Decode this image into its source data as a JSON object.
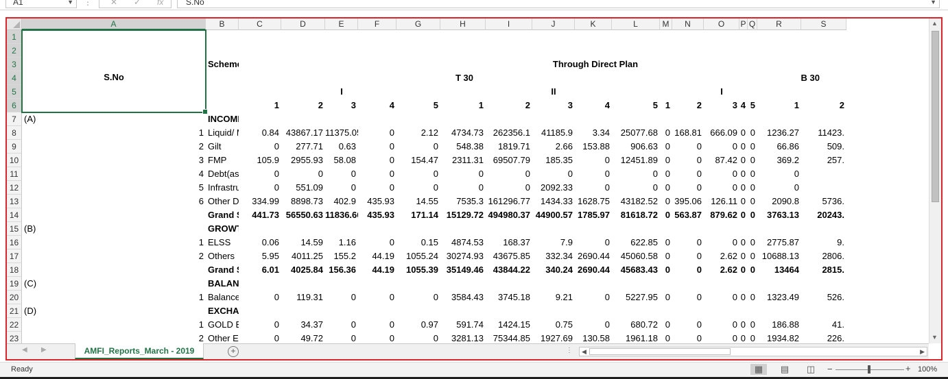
{
  "formula_bar": {
    "name_box": "A1",
    "formula": "S.No",
    "cancel_glyph": "✕",
    "enter_glyph": "✓",
    "fx_glyph": "fx"
  },
  "columns": [
    "A",
    "B",
    "C",
    "D",
    "E",
    "F",
    "G",
    "H",
    "I",
    "J",
    "K",
    "L",
    "M",
    "N",
    "O",
    "P",
    "Q",
    "R",
    "S"
  ],
  "rows": [
    "1",
    "2",
    "3",
    "4",
    "5",
    "6",
    "7",
    "8",
    "9",
    "10",
    "11",
    "12",
    "13",
    "14",
    "15",
    "16",
    "17",
    "18",
    "19",
    "20",
    "21",
    "22",
    "23"
  ],
  "cells": {
    "A3": "S.No",
    "B3": "Scheme Category / Scheme Name",
    "K3": "Through Direct Plan",
    "H4": "T 30",
    "S4": "B 30",
    "E5": "I",
    "J5": "II",
    "O5": "I",
    "C6": "1",
    "D6": "2",
    "E6": "3",
    "F6": "4",
    "G6": "5",
    "H6": "1",
    "I6": "2",
    "J6": "3",
    "K6": "4",
    "L6": "5",
    "M6": "1",
    "N6": "2",
    "O6": "3",
    "P6": "4",
    "Q6": "5",
    "R6": "1",
    "S6": "2",
    "A7": "(A)",
    "B7": "INCOME / DEBT ORIENTED SCHEMES",
    "A8": "1",
    "B8": "Liquid/ Money Market",
    "C8": "0.84",
    "D8": "43867.17",
    "E8": "11375.05",
    "F8": "0",
    "G8": "2.12",
    "H8": "4734.73",
    "I8": "262356.1",
    "J8": "41185.9",
    "K8": "3.34",
    "L8": "25077.68",
    "M8": "0",
    "N8": "168.81",
    "O8": "666.09",
    "P8": "0",
    "Q8": "0",
    "R8": "1236.27",
    "S8": "11423.",
    "A9": "2",
    "B9": "Gilt",
    "C9": "0",
    "D9": "277.71",
    "E9": "0.63",
    "F9": "0",
    "G9": "0",
    "H9": "548.38",
    "I9": "1819.71",
    "J9": "2.66",
    "K9": "153.88",
    "L9": "906.63",
    "M9": "0",
    "N9": "0",
    "O9": "0",
    "P9": "0",
    "Q9": "0",
    "R9": "66.86",
    "S9": "509.",
    "A10": "3",
    "B10": "FMP",
    "C10": "105.9",
    "D10": "2955.93",
    "E10": "58.08",
    "F10": "0",
    "G10": "154.47",
    "H10": "2311.31",
    "I10": "69507.79",
    "J10": "185.35",
    "K10": "0",
    "L10": "12451.89",
    "M10": "0",
    "N10": "0",
    "O10": "87.42",
    "P10": "0",
    "Q10": "0",
    "R10": "369.2",
    "S10": "257.",
    "A11": "4",
    "B11": "Debt(assured return)",
    "C11": "0",
    "D11": "0",
    "E11": "0",
    "F11": "0",
    "G11": "0",
    "H11": "0",
    "I11": "0",
    "J11": "0",
    "K11": "0",
    "L11": "0",
    "M11": "0",
    "N11": "0",
    "O11": "0",
    "P11": "0",
    "Q11": "0",
    "R11": "0",
    "A12": "5",
    "B12": "Infrastructure Debt Funds",
    "C12": "0",
    "D12": "551.09",
    "E12": "0",
    "F12": "0",
    "G12": "0",
    "H12": "0",
    "I12": "0",
    "J12": "2092.33",
    "K12": "0",
    "L12": "0",
    "M12": "0",
    "N12": "0",
    "O12": "0",
    "P12": "0",
    "Q12": "0",
    "R12": "0",
    "A13": "6",
    "B13": "Other Debt Schemes",
    "C13": "334.99",
    "D13": "8898.73",
    "E13": "402.9",
    "F13": "435.93",
    "G13": "14.55",
    "H13": "7535.3",
    "I13": "161296.77",
    "J13": "1434.33",
    "K13": "1628.75",
    "L13": "43182.52",
    "M13": "0",
    "N13": "395.06",
    "O13": "126.11",
    "P13": "0",
    "Q13": "0",
    "R13": "2090.8",
    "S13": "5736.",
    "B14": "Grand Sub-Total",
    "C14": "441.73",
    "D14": "56550.63",
    "E14": "11836.66",
    "F14": "435.93",
    "G14": "171.14",
    "H14": "15129.72",
    "I14": "494980.37",
    "J14": "44900.57",
    "K14": "1785.97",
    "L14": "81618.72",
    "M14": "0",
    "N14": "563.87",
    "O14": "879.62",
    "P14": "0",
    "Q14": "0",
    "R14": "3763.13",
    "S14": "20243.",
    "A15": "(B)",
    "B15": "GROWTH / EQUITY ORIENTED SCHEMES",
    "A16": "1",
    "B16": "ELSS",
    "C16": "0.06",
    "D16": "14.59",
    "E16": "1.16",
    "F16": "0",
    "G16": "0.15",
    "H16": "4874.53",
    "I16": "168.37",
    "J16": "7.9",
    "K16": "0",
    "L16": "622.85",
    "M16": "0",
    "N16": "0",
    "O16": "0",
    "P16": "0",
    "Q16": "0",
    "R16": "2775.87",
    "S16": "9.",
    "A17": "2",
    "B17": "Others",
    "C17": "5.95",
    "D17": "4011.25",
    "E17": "155.2",
    "F17": "44.19",
    "G17": "1055.24",
    "H17": "30274.93",
    "I17": "43675.85",
    "J17": "332.34",
    "K17": "2690.44",
    "L17": "45060.58",
    "M17": "0",
    "N17": "0",
    "O17": "2.62",
    "P17": "0",
    "Q17": "0",
    "R17": "10688.13",
    "S17": "2806.",
    "B18": "Grand Sub-Total",
    "C18": "6.01",
    "D18": "4025.84",
    "E18": "156.36",
    "F18": "44.19",
    "G18": "1055.39",
    "H18": "35149.46",
    "I18": "43844.22",
    "J18": "340.24",
    "K18": "2690.44",
    "L18": "45683.43",
    "M18": "0",
    "N18": "0",
    "O18": "2.62",
    "P18": "0",
    "Q18": "0",
    "R18": "13464",
    "S18": "2815.",
    "A19": "(C)",
    "B19": "BALANCED SCHEMES",
    "A20": "1",
    "B20": "Balanced schemes",
    "C20": "0",
    "D20": "119.31",
    "E20": "0",
    "F20": "0",
    "G20": "0",
    "H20": "3584.43",
    "I20": "3745.18",
    "J20": "9.21",
    "K20": "0",
    "L20": "5227.95",
    "M20": "0",
    "N20": "0",
    "O20": "0",
    "P20": "0",
    "Q20": "0",
    "R20": "1323.49",
    "S20": "526.",
    "A21": "(D)",
    "B21": "EXCHANGE TRADED FUND",
    "A22": "1",
    "B22": "GOLD ETF",
    "C22": "0",
    "D22": "34.37",
    "E22": "0",
    "F22": "0",
    "G22": "0.97",
    "H22": "591.74",
    "I22": "1424.15",
    "J22": "0.75",
    "K22": "0",
    "L22": "680.72",
    "M22": "0",
    "N22": "0",
    "O22": "0",
    "P22": "0",
    "Q22": "0",
    "R22": "186.88",
    "S22": "41.",
    "A23": "2",
    "B23": "Other ETFs",
    "C23": "0",
    "D23": "49.72",
    "E23": "0",
    "F23": "0",
    "G23": "0",
    "H23": "3281.13",
    "I23": "75344.85",
    "J23": "1927.69",
    "K23": "130.58",
    "L23": "1961.18",
    "M23": "0",
    "N23": "0",
    "O23": "0",
    "P23": "0",
    "Q23": "0",
    "R23": "1934.82",
    "S23": "226."
  },
  "sheet_tab": "AMFI_Reports_March - 2019",
  "add_sheet_glyph": "+",
  "status": {
    "text": "Ready",
    "zoom": "100%"
  },
  "colors": {
    "accent": "#217346",
    "frame": "#d9262b"
  }
}
